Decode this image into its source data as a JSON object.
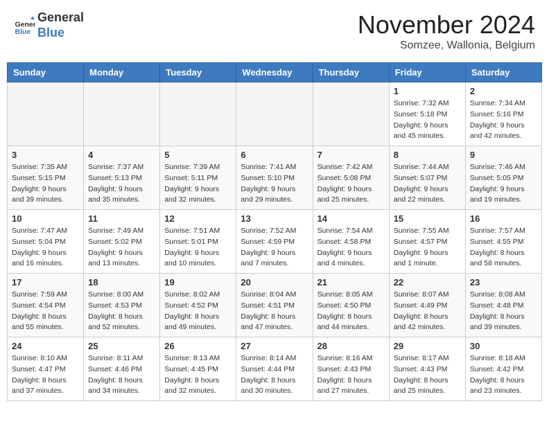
{
  "header": {
    "logo_line1": "General",
    "logo_line2": "Blue",
    "month_year": "November 2024",
    "location": "Somzee, Wallonia, Belgium"
  },
  "weekdays": [
    "Sunday",
    "Monday",
    "Tuesday",
    "Wednesday",
    "Thursday",
    "Friday",
    "Saturday"
  ],
  "weeks": [
    [
      {
        "day": "",
        "info": ""
      },
      {
        "day": "",
        "info": ""
      },
      {
        "day": "",
        "info": ""
      },
      {
        "day": "",
        "info": ""
      },
      {
        "day": "",
        "info": ""
      },
      {
        "day": "1",
        "info": "Sunrise: 7:32 AM\nSunset: 5:18 PM\nDaylight: 9 hours and 45 minutes."
      },
      {
        "day": "2",
        "info": "Sunrise: 7:34 AM\nSunset: 5:16 PM\nDaylight: 9 hours and 42 minutes."
      }
    ],
    [
      {
        "day": "3",
        "info": "Sunrise: 7:35 AM\nSunset: 5:15 PM\nDaylight: 9 hours and 39 minutes."
      },
      {
        "day": "4",
        "info": "Sunrise: 7:37 AM\nSunset: 5:13 PM\nDaylight: 9 hours and 35 minutes."
      },
      {
        "day": "5",
        "info": "Sunrise: 7:39 AM\nSunset: 5:11 PM\nDaylight: 9 hours and 32 minutes."
      },
      {
        "day": "6",
        "info": "Sunrise: 7:41 AM\nSunset: 5:10 PM\nDaylight: 9 hours and 29 minutes."
      },
      {
        "day": "7",
        "info": "Sunrise: 7:42 AM\nSunset: 5:08 PM\nDaylight: 9 hours and 25 minutes."
      },
      {
        "day": "8",
        "info": "Sunrise: 7:44 AM\nSunset: 5:07 PM\nDaylight: 9 hours and 22 minutes."
      },
      {
        "day": "9",
        "info": "Sunrise: 7:46 AM\nSunset: 5:05 PM\nDaylight: 9 hours and 19 minutes."
      }
    ],
    [
      {
        "day": "10",
        "info": "Sunrise: 7:47 AM\nSunset: 5:04 PM\nDaylight: 9 hours and 16 minutes."
      },
      {
        "day": "11",
        "info": "Sunrise: 7:49 AM\nSunset: 5:02 PM\nDaylight: 9 hours and 13 minutes."
      },
      {
        "day": "12",
        "info": "Sunrise: 7:51 AM\nSunset: 5:01 PM\nDaylight: 9 hours and 10 minutes."
      },
      {
        "day": "13",
        "info": "Sunrise: 7:52 AM\nSunset: 4:59 PM\nDaylight: 9 hours and 7 minutes."
      },
      {
        "day": "14",
        "info": "Sunrise: 7:54 AM\nSunset: 4:58 PM\nDaylight: 9 hours and 4 minutes."
      },
      {
        "day": "15",
        "info": "Sunrise: 7:55 AM\nSunset: 4:57 PM\nDaylight: 9 hours and 1 minute."
      },
      {
        "day": "16",
        "info": "Sunrise: 7:57 AM\nSunset: 4:55 PM\nDaylight: 8 hours and 58 minutes."
      }
    ],
    [
      {
        "day": "17",
        "info": "Sunrise: 7:59 AM\nSunset: 4:54 PM\nDaylight: 8 hours and 55 minutes."
      },
      {
        "day": "18",
        "info": "Sunrise: 8:00 AM\nSunset: 4:53 PM\nDaylight: 8 hours and 52 minutes."
      },
      {
        "day": "19",
        "info": "Sunrise: 8:02 AM\nSunset: 4:52 PM\nDaylight: 8 hours and 49 minutes."
      },
      {
        "day": "20",
        "info": "Sunrise: 8:04 AM\nSunset: 4:51 PM\nDaylight: 8 hours and 47 minutes."
      },
      {
        "day": "21",
        "info": "Sunrise: 8:05 AM\nSunset: 4:50 PM\nDaylight: 8 hours and 44 minutes."
      },
      {
        "day": "22",
        "info": "Sunrise: 8:07 AM\nSunset: 4:49 PM\nDaylight: 8 hours and 42 minutes."
      },
      {
        "day": "23",
        "info": "Sunrise: 8:08 AM\nSunset: 4:48 PM\nDaylight: 8 hours and 39 minutes."
      }
    ],
    [
      {
        "day": "24",
        "info": "Sunrise: 8:10 AM\nSunset: 4:47 PM\nDaylight: 8 hours and 37 minutes."
      },
      {
        "day": "25",
        "info": "Sunrise: 8:11 AM\nSunset: 4:46 PM\nDaylight: 8 hours and 34 minutes."
      },
      {
        "day": "26",
        "info": "Sunrise: 8:13 AM\nSunset: 4:45 PM\nDaylight: 8 hours and 32 minutes."
      },
      {
        "day": "27",
        "info": "Sunrise: 8:14 AM\nSunset: 4:44 PM\nDaylight: 8 hours and 30 minutes."
      },
      {
        "day": "28",
        "info": "Sunrise: 8:16 AM\nSunset: 4:43 PM\nDaylight: 8 hours and 27 minutes."
      },
      {
        "day": "29",
        "info": "Sunrise: 8:17 AM\nSunset: 4:43 PM\nDaylight: 8 hours and 25 minutes."
      },
      {
        "day": "30",
        "info": "Sunrise: 8:18 AM\nSunset: 4:42 PM\nDaylight: 8 hours and 23 minutes."
      }
    ]
  ]
}
